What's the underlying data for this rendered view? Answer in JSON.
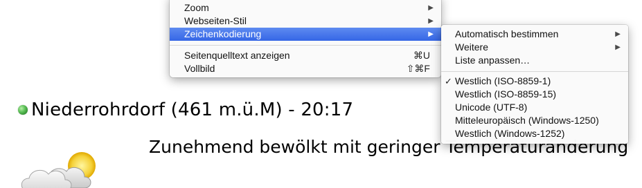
{
  "page": {
    "location": "Niederrohrdorf (461 m.ü.M) - 20:17",
    "forecast": "Zunehmend bewölkt mit geringer Temperaturänderung",
    "weather_icon": "cloud-sun-icon",
    "status_color": "#4caf50"
  },
  "menu": {
    "items": [
      {
        "label": "Zoom",
        "has_submenu": true
      },
      {
        "label": "Webseiten-Stil",
        "has_submenu": true
      },
      {
        "label": "Zeichenkodierung",
        "has_submenu": true,
        "selected": true
      },
      {
        "label": "Seitenquelltext anzeigen",
        "shortcut": "⌘U"
      },
      {
        "label": "Vollbild",
        "shortcut": "⇧⌘F"
      }
    ]
  },
  "submenu": {
    "items": [
      {
        "label": "Automatisch bestimmen",
        "has_submenu": true
      },
      {
        "label": "Weitere",
        "has_submenu": true
      },
      {
        "label": "Liste anpassen…"
      },
      {
        "label": "Westlich (ISO-8859-1)",
        "checked": true
      },
      {
        "label": "Westlich (ISO-8859-15)"
      },
      {
        "label": "Unicode (UTF-8)"
      },
      {
        "label": "Mitteleuropäisch (Windows-1250)"
      },
      {
        "label": "Westlich (Windows-1252)"
      }
    ]
  },
  "icons": {
    "arrow": "▶",
    "check": "✓"
  },
  "colors": {
    "highlight": "#3e6fe8"
  }
}
